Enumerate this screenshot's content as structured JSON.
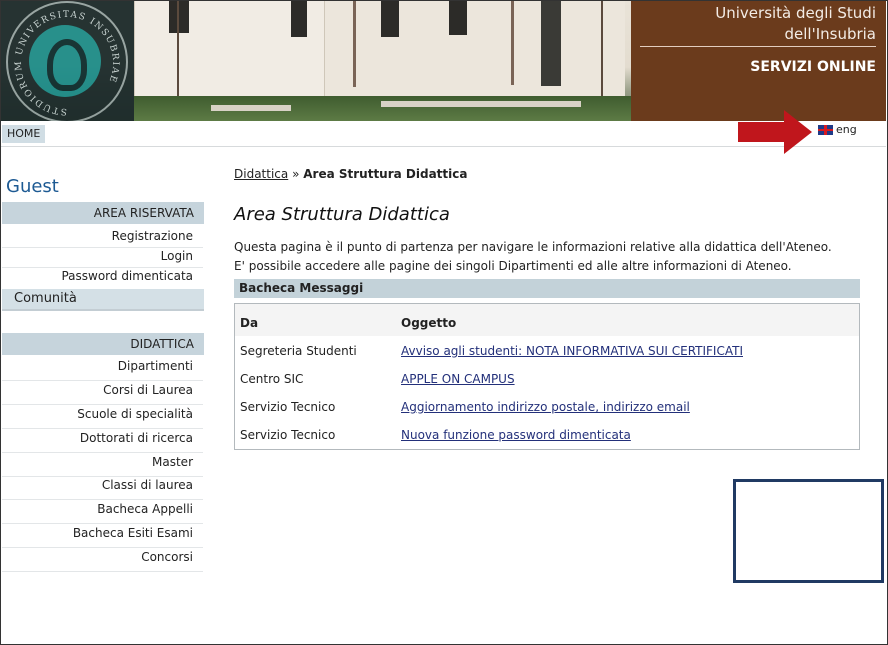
{
  "header": {
    "university_line1": "Università degli Studi",
    "university_line2": "dell'Insubria",
    "services": "SERVIZI ONLINE",
    "logo_icon": "university-seal-icon",
    "logo_text": "STUDIORUM UNIVERSITAS INSUBRIAE"
  },
  "navbar": {
    "home": "HOME",
    "lang": "eng",
    "flag_icon": "uk-flag-icon",
    "arrow_icon": "red-arrow-icon"
  },
  "sidebar": {
    "user": "Guest",
    "area_riservata": {
      "heading": "AREA RISERVATA",
      "items": [
        "Registrazione",
        "Login",
        "Password dimenticata"
      ]
    },
    "comunita": "Comunità",
    "didattica": {
      "heading": "DIDATTICA",
      "items": [
        "Dipartimenti",
        "Corsi di Laurea",
        "Scuole di specialità",
        "Dottorati di ricerca",
        "Master",
        "Classi di laurea",
        "Bacheca Appelli",
        "Bacheca Esiti Esami",
        "Concorsi"
      ]
    }
  },
  "main": {
    "breadcrumb_link": "Didattica",
    "breadcrumb_sep": "»",
    "breadcrumb_current": "Area Struttura Didattica",
    "title": "Area Struttura Didattica",
    "intro": "Questa pagina è il punto di partenza per navigare le informazioni relative alla didattica dell'Ateneo. E' possibile accedere alle pagine dei singoli Dipartimenti ed alle altre informazioni di Ateneo.",
    "board_title": "Bacheca Messaggi",
    "columns": [
      "Da",
      "Oggetto"
    ],
    "messages": [
      {
        "from": "Segreteria Studenti",
        "subject": "Avviso agli studenti: NOTA INFORMATIVA SUI CERTIFICATI"
      },
      {
        "from": "Centro SIC",
        "subject": "APPLE ON CAMPUS"
      },
      {
        "from": "Servizio Tecnico",
        "subject": "Aggiornamento indirizzo postale, indirizzo email"
      },
      {
        "from": "Servizio Tecnico",
        "subject": "Nuova funzione password dimenticata"
      }
    ]
  },
  "colors": {
    "accent_blue": "#1d5a93",
    "sidebar_header": "#c6d4dc",
    "annotation_red": "#c0161c",
    "annotation_box": "#203a63"
  }
}
